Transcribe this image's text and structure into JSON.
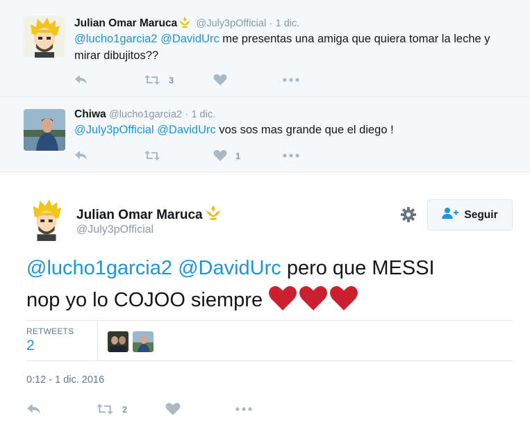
{
  "replies": [
    {
      "fullname": "Julian Omar Maruca",
      "handle": "@July3pOfficial",
      "sep": "·",
      "time": "1 dic.",
      "mention1": "@lucho1garcia2",
      "mention2": "@DavidUrc",
      "text": " me presentas una amiga que quiera tomar la leche y mirar dibujitos??",
      "retweet_count": "3",
      "like_count": ""
    },
    {
      "fullname": "Chiwa",
      "handle": "@lucho1garcia2",
      "sep": "·",
      "time": "1 dic.",
      "mention1": "@July3pOfficial",
      "mention2": "@DavidUrc",
      "text": " vos sos mas grande que el diego !",
      "retweet_count": "",
      "like_count": "1"
    }
  ],
  "main_tweet": {
    "fullname": "Julian Omar Maruca",
    "handle": "@July3pOfficial",
    "follow_label": "Seguir",
    "mention1": "@lucho1garcia2",
    "mention2": "@DavidUrc",
    "text_line1_tail": " pero que MESSI",
    "text_line2": "nop yo lo COJOO siempre ",
    "retweets_label": "RETWEETS",
    "retweets_count": "2",
    "timestamp": "0:12 - 1 dic. 2016",
    "retweet_count": "2"
  },
  "icons": {
    "reply": "reply-icon",
    "retweet": "retweet-icon",
    "like": "heart-icon",
    "more": "more-icon",
    "gear": "gear-icon",
    "follow": "follow-user-icon",
    "badge": "crown-badge-icon",
    "emoji": "red-heart-emoji"
  },
  "colors": {
    "link": "#1b95e0",
    "muted": "#8899a6",
    "icon": "#aab8c2",
    "heart_emoji": "#cc1f2f",
    "badge": "#f5b800"
  }
}
